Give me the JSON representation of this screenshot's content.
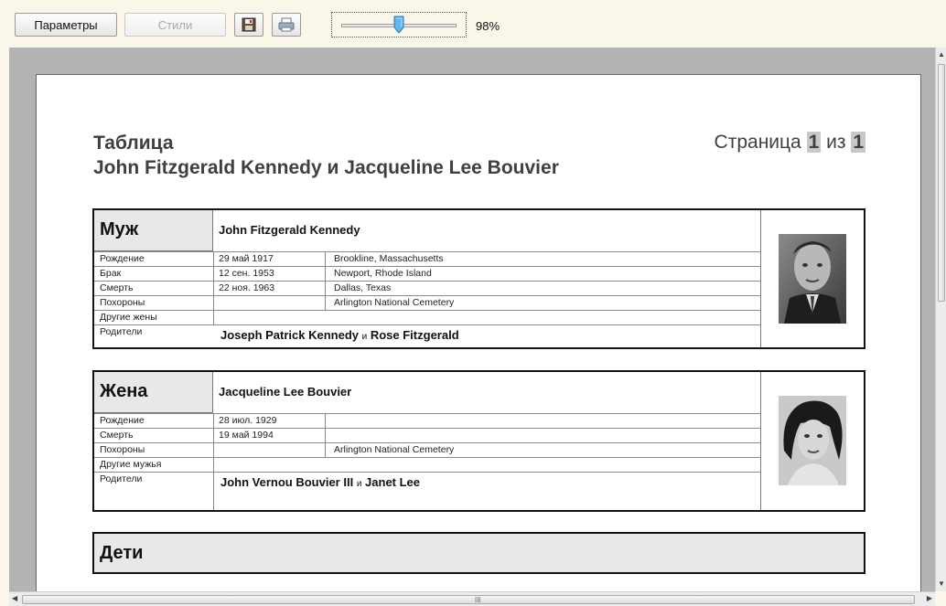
{
  "toolbar": {
    "params_label": "Параметры",
    "styles_label": "Стили",
    "save_icon": "save-icon",
    "print_icon": "print-icon",
    "zoom_value": 98,
    "zoom_label": "98%"
  },
  "report": {
    "title": "Таблица",
    "subtitle": "John Fitzgerald Kennedy и Jacqueline Lee Bouvier",
    "page_label": "Страница",
    "page_current": "1",
    "page_of": "из",
    "page_total": "1",
    "husband": {
      "role": "Муж",
      "name": "John Fitzgerald Kennedy",
      "rows": [
        {
          "label": "Рождение",
          "date": "29 май 1917",
          "place": "Brookline, Massachusetts"
        },
        {
          "label": "Брак",
          "date": "12 сен. 1953",
          "place": "Newport, Rhode Island"
        },
        {
          "label": "Смерть",
          "date": "22 ноя. 1963",
          "place": "Dallas, Texas"
        },
        {
          "label": "Похороны",
          "date": "",
          "place": "Arlington National Cemetery"
        },
        {
          "label": "Другие жены",
          "date": "",
          "place": ""
        }
      ],
      "parents_label": "Родители",
      "father": "Joseph Patrick Kennedy",
      "and": "и",
      "mother": "Rose Fitzgerald"
    },
    "wife": {
      "role": "Жена",
      "name": "Jacqueline Lee Bouvier",
      "rows": [
        {
          "label": "Рождение",
          "date": "28 июл. 1929",
          "place": ""
        },
        {
          "label": "Смерть",
          "date": "19 май 1994",
          "place": ""
        },
        {
          "label": "Похороны",
          "date": "",
          "place": "Arlington National Cemetery"
        },
        {
          "label": "Другие мужья",
          "date": "",
          "place": ""
        }
      ],
      "parents_label": "Родители",
      "father": "John Vernou Bouvier III",
      "and": "и",
      "mother": "Janet Lee"
    },
    "children": {
      "role": "Дети"
    }
  },
  "scrollbar": {
    "horizontal_grip": "III"
  }
}
